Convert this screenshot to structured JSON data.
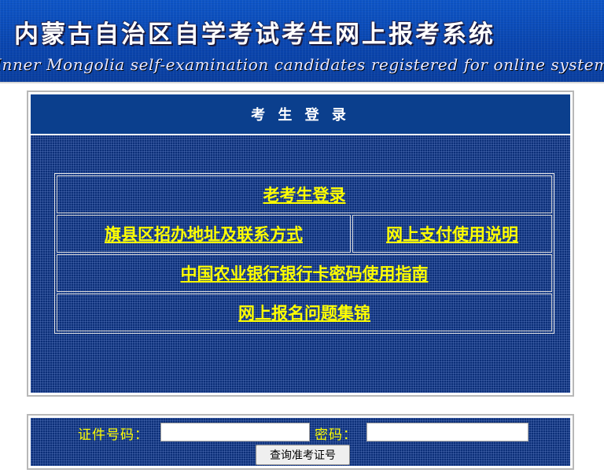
{
  "banner": {
    "title": "内蒙古自治区自学考试考生网上报考系统",
    "subtitle": "Inner Mongolia self-examination candidates registered for online system"
  },
  "login_panel": {
    "heading": "考 生 登 录",
    "links": {
      "returning_candidate_login": "老考生登录",
      "county_office_contacts": "旗县区招办地址及联系方式",
      "online_payment_guide": "网上支付使用说明",
      "abc_card_password_guide": "中国农业银行银行卡密码使用指南",
      "registration_faq": "网上报名问题集锦"
    }
  },
  "query_form": {
    "id_label": "证件号码：",
    "id_value": "",
    "password_label": "密码：",
    "password_value": "",
    "submit_label": "查询准考证号"
  },
  "colors": {
    "banner_blue": "#0a46b0",
    "panel_header": "#0b3f8d",
    "panel_body": "#0c2f78",
    "link_yellow": "#ffff00"
  }
}
